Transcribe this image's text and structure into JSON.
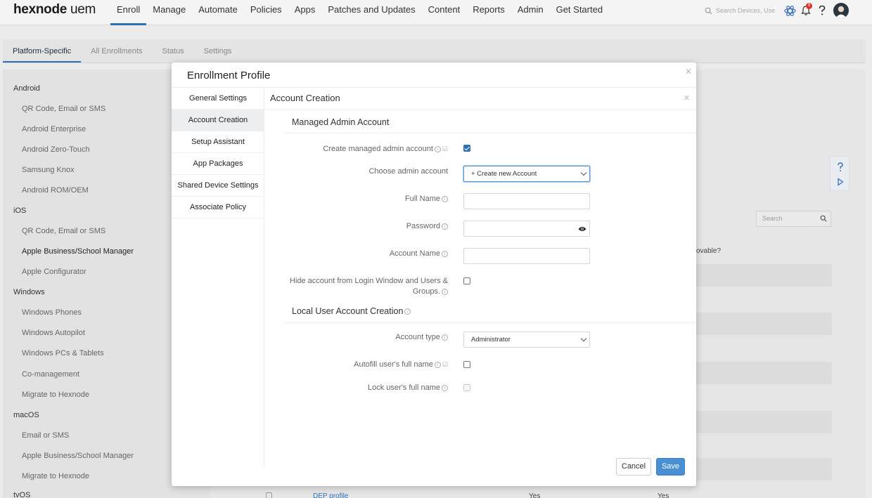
{
  "app": {
    "logo_bold": "hexnode",
    "logo_rest": " uem"
  },
  "nav": [
    "Enroll",
    "Manage",
    "Automate",
    "Policies",
    "Apps",
    "Patches and Updates",
    "Content",
    "Reports",
    "Admin",
    "Get Started"
  ],
  "top_search": {
    "placeholder": "Search Devices, Use"
  },
  "notifications": {
    "count": "9"
  },
  "subtabs": [
    "Platform-Specific",
    "All Enrollments",
    "Status",
    "Settings"
  ],
  "sidebar": {
    "android": "Android",
    "android_items": [
      "QR Code, Email or SMS",
      "Android Enterprise",
      "Android Zero-Touch",
      "Samsung Knox",
      "Android ROM/OEM"
    ],
    "ios": "iOS",
    "ios_items": [
      "QR Code, Email or SMS",
      "Apple Business/School Manager",
      "Apple Configurator"
    ],
    "windows": "Windows",
    "windows_items": [
      "Windows Phones",
      "Windows Autopilot",
      "Windows PCs & Tablets",
      "Co-management",
      "Migrate to Hexnode"
    ],
    "macos": "macOS",
    "macos_items": [
      "Email or SMS",
      "Apple Business/School Manager",
      "Migrate to Hexnode"
    ],
    "tvos": "tvOS"
  },
  "background": {
    "search_placeholder": "Search",
    "removable_text": "ovable?",
    "dep_link": "DEP profile",
    "yes1": "Yes",
    "yes2": "Yes"
  },
  "modal": {
    "title": "Enrollment Profile",
    "menu": [
      "General Settings",
      "Account Creation",
      "Setup Assistant",
      "App Packages",
      "Shared Device Settings",
      "Associate Policy"
    ],
    "panel_title": "Account Creation",
    "section1": "Managed Admin Account",
    "fields": {
      "create_admin": "Create managed admin account",
      "choose_admin": "Choose admin account",
      "choose_admin_value": "+ Create new Account",
      "full_name": "Full Name",
      "password": "Password",
      "account_name": "Account Name",
      "hide_account": "Hide account from Login Window and Users & Groups."
    },
    "section2": "Local User Account Creation",
    "fields2": {
      "account_type": "Account type",
      "account_type_value": "Administrator",
      "autofill": "Autofill user's full name",
      "lock": "Lock user's full name"
    },
    "cancel": "Cancel",
    "save": "Save"
  }
}
